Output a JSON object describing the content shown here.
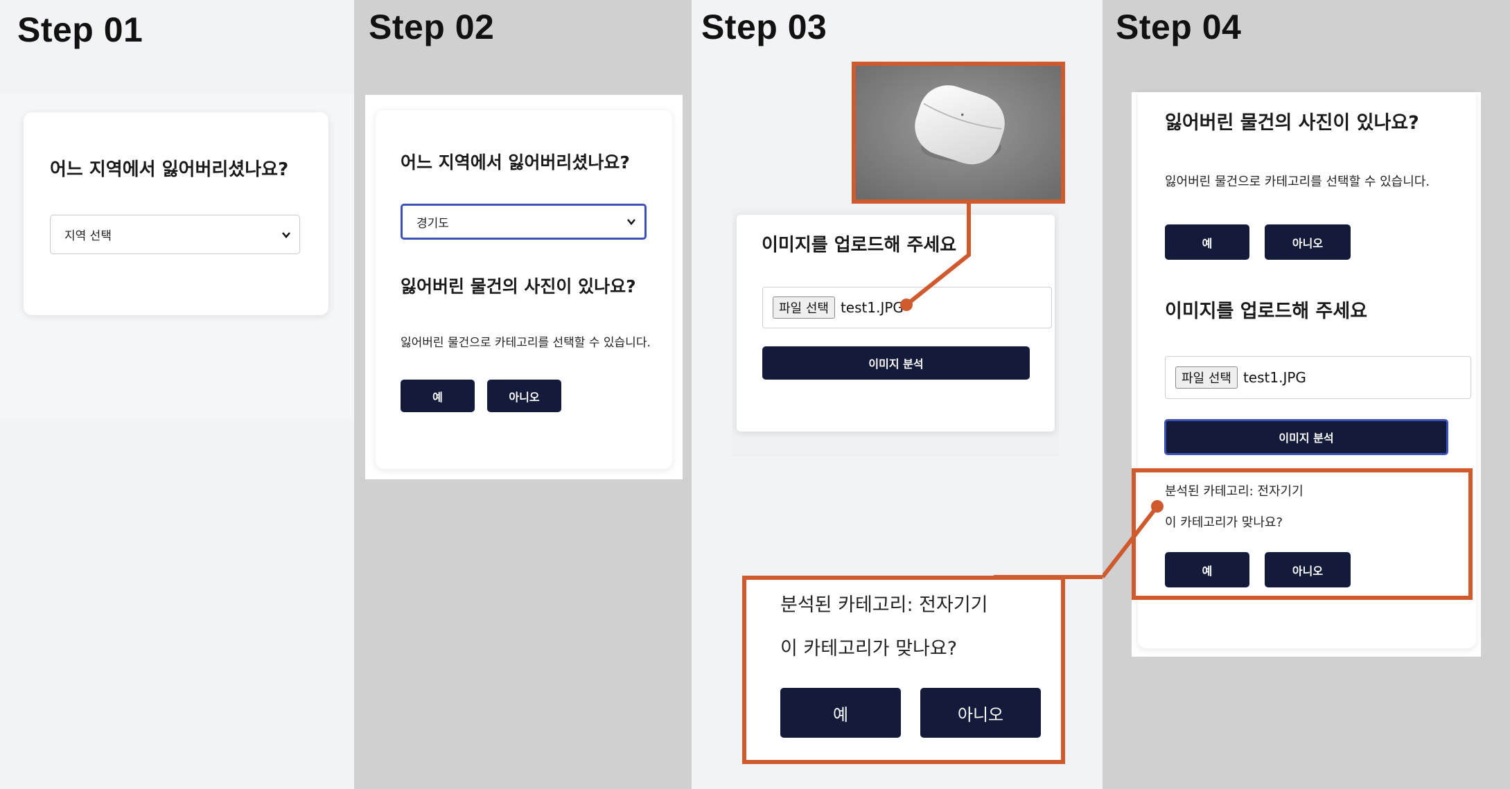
{
  "steps": [
    "Step 01",
    "Step 02",
    "Step 03",
    "Step 04"
  ],
  "step1": {
    "question": "어느 지역에서 잃어버리셨나요?",
    "region_select": "지역 선택"
  },
  "step2": {
    "question": "어느 지역에서 잃어버리셨나요?",
    "region_select": "경기도",
    "photo_question": "잃어버린 물건의 사진이 있나요?",
    "photo_desc": "잃어버린 물건으로 카테고리를 선택할 수 있습니다.",
    "yes": "예",
    "no": "아니오"
  },
  "step3": {
    "upload_title": "이미지를 업로드해 주세요",
    "file_button": "파일 선택",
    "file_name": "test1.JPG",
    "analyze_button": "이미지 분석",
    "result_category": "분석된 카테고리: 전자기기",
    "confirm_question": "이 카테고리가 맞나요?",
    "yes": "예",
    "no": "아니오"
  },
  "step4": {
    "photo_question": "잃어버린 물건의 사진이 있나요?",
    "photo_desc": "잃어버린 물건으로 카테고리를 선택할 수 있습니다.",
    "yes": "예",
    "no": "아니오",
    "upload_title": "이미지를 업로드해 주세요",
    "file_button": "파일 선택",
    "file_name": "test1.JPG",
    "analyze_button": "이미지 분석",
    "result_category": "분석된 카테고리: 전자기기",
    "confirm_question": "이 카테고리가 맞나요?",
    "yes2": "예",
    "no2": "아니오"
  },
  "colors": {
    "accent": "#cf5a2e",
    "button": "#141a3a",
    "focus": "#3a52b5"
  },
  "icons": [
    "chevron-down-icon",
    "earbuds-case-photo"
  ]
}
